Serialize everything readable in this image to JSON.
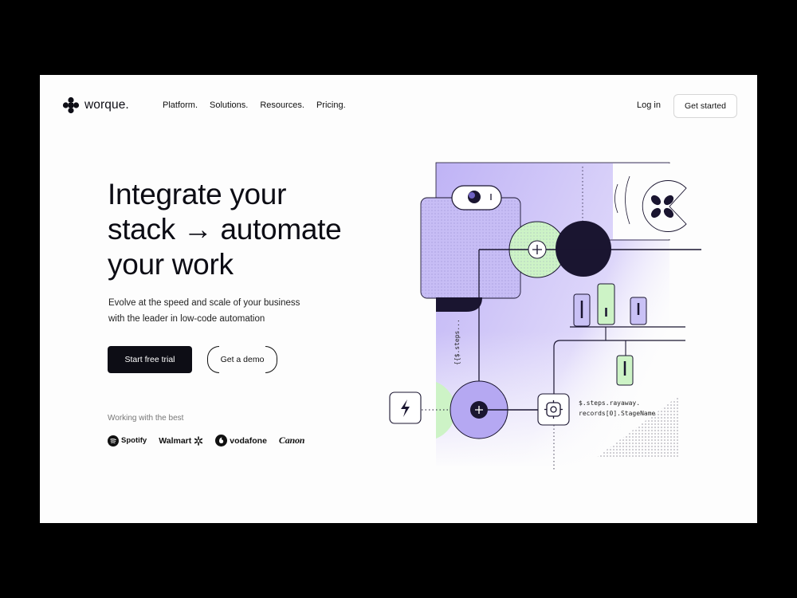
{
  "brand": {
    "name": "worque."
  },
  "nav": {
    "items": [
      "Platform.",
      "Solutions.",
      "Resources.",
      "Pricing."
    ],
    "login": "Log in",
    "cta": "Get started"
  },
  "hero": {
    "title_lines": [
      "Integrate your",
      "stack → automate",
      "your work"
    ],
    "subtitle_lines": [
      "Evolve  at the speed and scale of your business",
      "with the leader in low-code automation"
    ],
    "primary_cta": "Start free trial",
    "secondary_cta": "Get a demo"
  },
  "partners": {
    "label": "Working with the best",
    "logos": [
      "Spotify",
      "Walmart",
      "vodafone",
      "Canon"
    ]
  },
  "illustration": {
    "code_vertical": "{{$.steps...",
    "code_line1": "$.steps.rayaway.",
    "code_line2": "records[0].StageName"
  },
  "colors": {
    "lavender": "#c9c1f5",
    "lavender_dark": "#b5a8f2",
    "mint": "#cdf3c6",
    "ink": "#1a1530",
    "page_bg": "#fdfdfd"
  }
}
